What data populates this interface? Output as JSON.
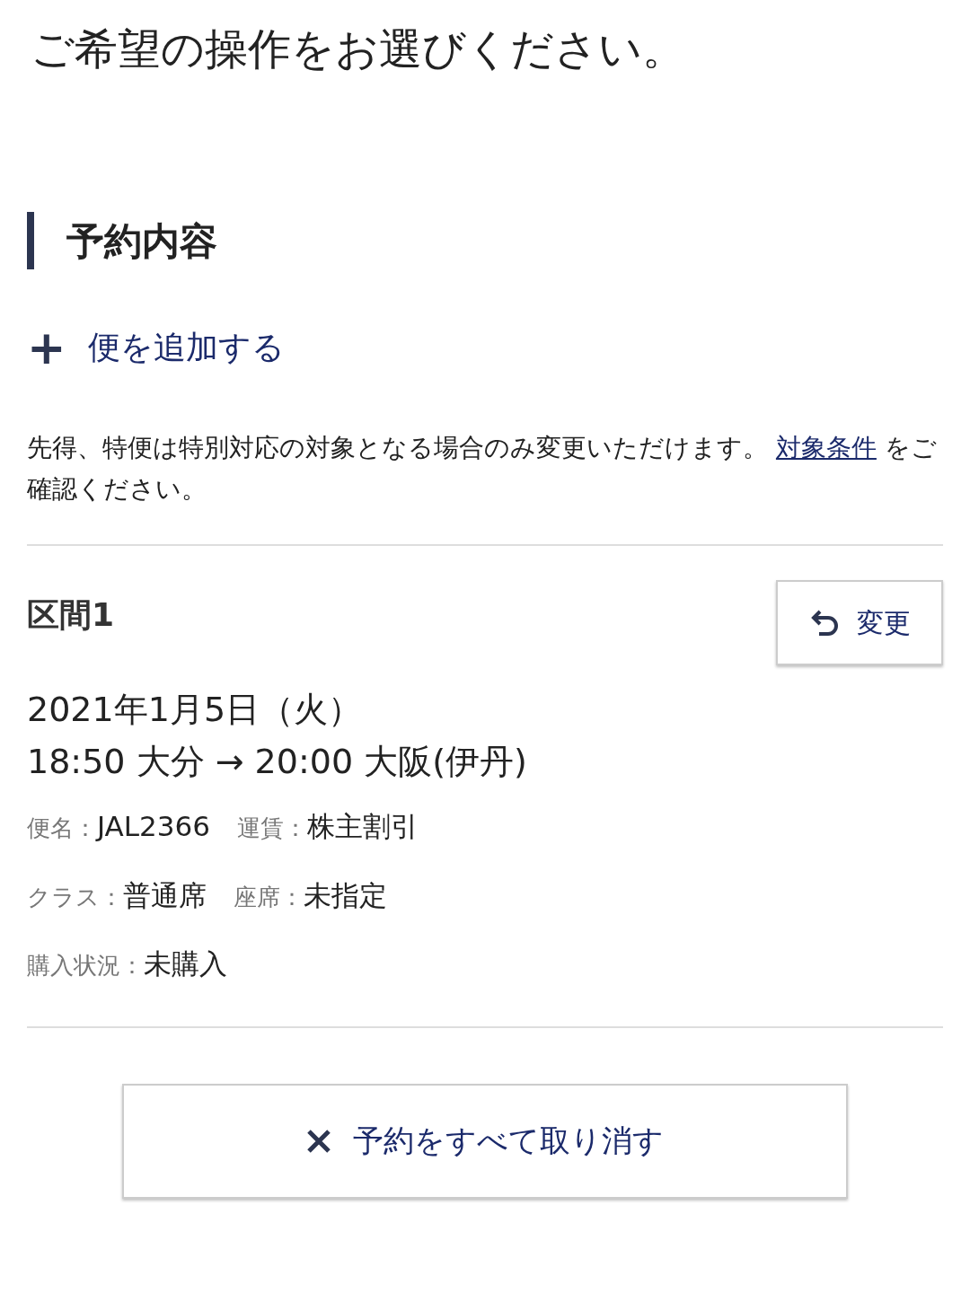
{
  "page_title": "ご希望の操作をお選びください。",
  "section_heading": "予約内容",
  "add_flight": {
    "icon": "+",
    "label": "便を追加する"
  },
  "notice": {
    "text": "先得、特便は特別対応の対象となる場合のみ変更いただけます。",
    "link": "対象条件",
    "after": "をご確認ください。"
  },
  "segment": {
    "label": "区間1",
    "change_button": "変更",
    "date": "2021年1月5日（火）",
    "route": "18:50 大分 → 20:00 大阪(伊丹)",
    "details": [
      [
        {
          "label": "便名：",
          "value": "JAL2366"
        },
        {
          "label": "運賃：",
          "value": "株主割引"
        }
      ],
      [
        {
          "label": "クラス：",
          "value": "普通席"
        },
        {
          "label": "座席：",
          "value": "未指定"
        }
      ],
      [
        {
          "label": "購入状況：",
          "value": "未購入"
        }
      ]
    ]
  },
  "cancel_button": "予約をすべて取り消す"
}
